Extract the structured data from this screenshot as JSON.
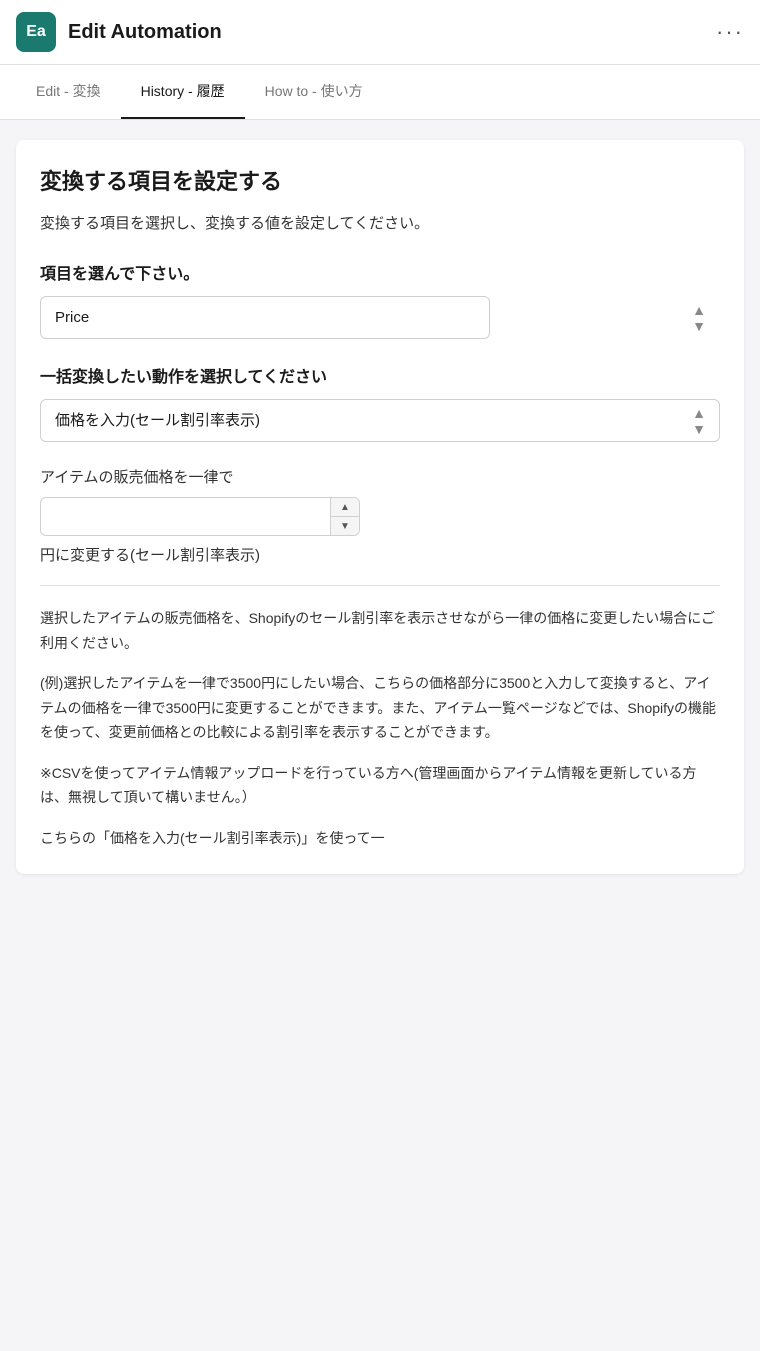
{
  "header": {
    "app_icon_label": "Ea",
    "title": "Edit Automation",
    "menu_icon": "···"
  },
  "tabs": [
    {
      "label": "Edit - 変換",
      "active": false
    },
    {
      "label": "History - 履歴",
      "active": true
    },
    {
      "label": "How to - 使い方",
      "active": false
    }
  ],
  "main": {
    "section_title": "変換する項目を設定する",
    "section_desc": "変換する項目を選択し、変換する値を設定してください。",
    "field_label": "項目を選んで下さい。",
    "field_select_value": "Price",
    "action_label": "一括変換したい動作を選択してください",
    "action_select_value": "価格を入力(セール割引率表示)",
    "number_input_label": "アイテムの販売価格を一律で",
    "number_input_value": "",
    "number_input_placeholder": "",
    "after_input_text": "円に変更する(セール割引率表示)",
    "description_1": "選択したアイテムの販売価格を、Shopifyのセール割引率を表示させながら一律の価格に変更したい場合にご利用ください。",
    "description_2": "(例)選択したアイテムを一律で3500円にしたい場合、こちらの価格部分に3500と入力して変換すると、アイテムの価格を一律で3500円に変更することができます。また、アイテム一覧ページなどでは、Shopifyの機能を使って、変更前価格との比較による割引率を表示することができます。",
    "description_3": "※CSVを使ってアイテム情報アップロードを行っている方へ(管理画面からアイテム情報を更新している方は、無視して頂いて構いません。）",
    "description_4": "こちらの「価格を入力(セール割引率表示)」を使って一"
  }
}
